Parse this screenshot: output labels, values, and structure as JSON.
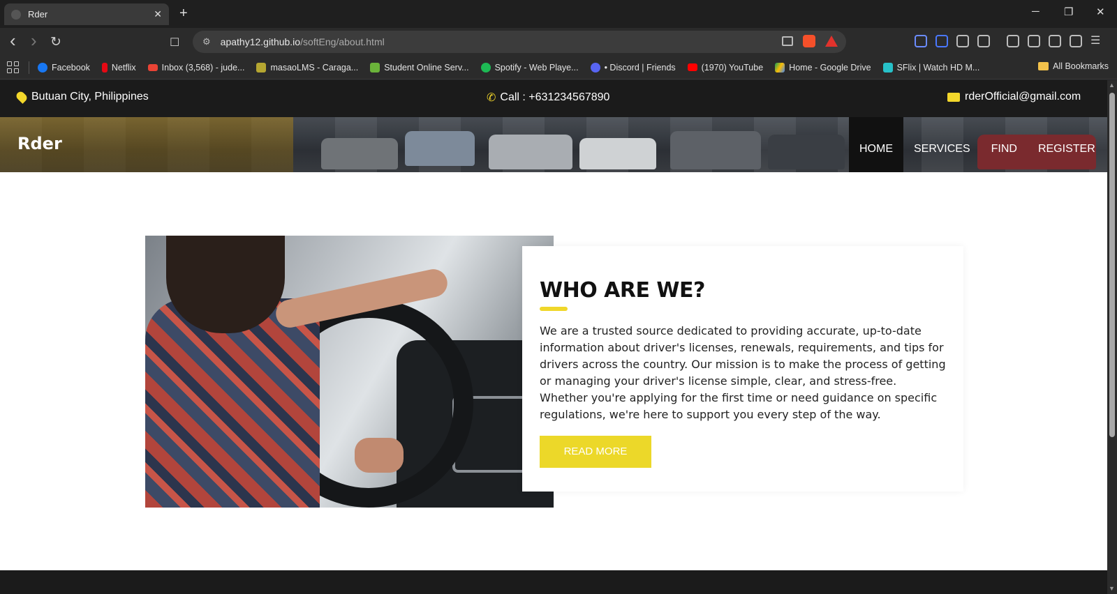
{
  "browser": {
    "tab_title": "Rder",
    "url_domain": "apathy12.github.io",
    "url_path": "/softEng/about.html",
    "new_tab": "+",
    "window_controls": {
      "minimize": "─",
      "restore": "❐",
      "close": "✕"
    },
    "nav": {
      "back": "‹",
      "forward": "›",
      "reload": "↻"
    },
    "bookmarks": [
      {
        "label": "Facebook",
        "color": "#1877f2"
      },
      {
        "label": "Netflix",
        "color": "#e50914"
      },
      {
        "label": "Inbox (3,568) - jude...",
        "color": "#ea4335"
      },
      {
        "label": "masaoLMS - Caraga...",
        "color": "#b5a631"
      },
      {
        "label": "Student Online Serv...",
        "color": "#6bb33a"
      },
      {
        "label": "Spotify - Web Playe...",
        "color": "#1db954"
      },
      {
        "label": "• Discord | Friends",
        "color": "#5865f2"
      },
      {
        "label": "(1970) YouTube",
        "color": "#ff0000"
      },
      {
        "label": "Home - Google Drive",
        "color": "#fbbc04"
      },
      {
        "label": "SFlix | Watch HD M...",
        "color": "#27c1c9"
      }
    ],
    "all_bookmarks": "All Bookmarks"
  },
  "topbar": {
    "location": "Butuan City, Philippines",
    "phone": "Call : +631234567890",
    "email": "rderOfficial@gmail.com",
    "accent_color": "#f3d72b"
  },
  "header": {
    "logo": "Rder",
    "nav": [
      "HOME",
      "SERVICES",
      "FIND",
      "REGISTER"
    ]
  },
  "about": {
    "title": "WHO ARE WE?",
    "body": "We are a trusted source dedicated to providing accurate, up-to-date information about driver's licenses, renewals, requirements, and tips for drivers across the country. Our mission is to make the process of getting or managing your driver's license simple, clear, and stress-free. Whether you're applying for the first time or need guidance on specific regulations, we're here to support you every step of the way.",
    "button": "READ MORE",
    "button_color": "#ecd829"
  }
}
